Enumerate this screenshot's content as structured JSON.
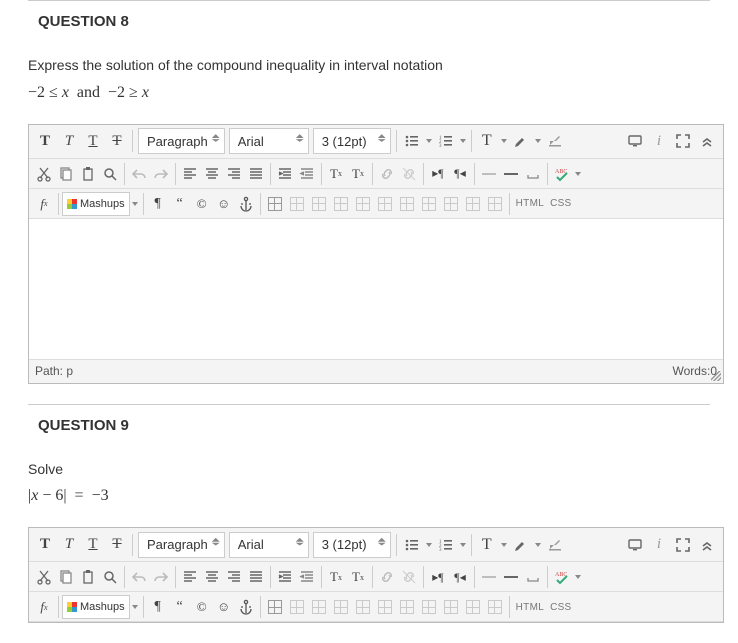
{
  "q8": {
    "heading": "QUESTION 8",
    "prompt": "Express the solution of the compound inequality in interval notation",
    "math": "−2 ≤ x  and  −2 ≥ x"
  },
  "q9": {
    "heading": "QUESTION 9",
    "prompt": "Solve",
    "math": "|x − 6|  =  −3"
  },
  "editor": {
    "para_select": "Paragraph",
    "font_select": "Arial",
    "size_select": "3 (12pt)",
    "mashups": "Mashups",
    "html_btn": "HTML",
    "css_btn": "CSS",
    "path_label": "Path:",
    "path_value": "p",
    "words_label": "Words:",
    "words_value": "0"
  }
}
